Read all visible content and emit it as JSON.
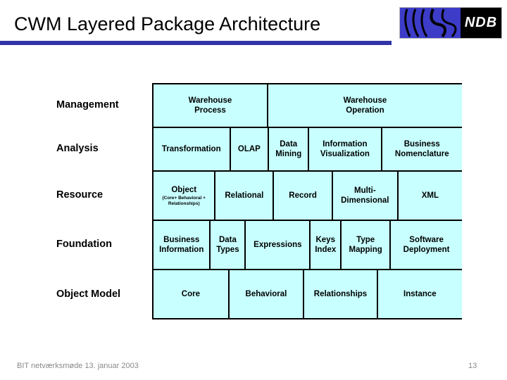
{
  "slide": {
    "title": "CWM Layered Package Architecture",
    "rule_color": "#3333a8",
    "cell_fill": "#c8ffff",
    "border_color": "#000000"
  },
  "logo": {
    "name": "ndb-logo",
    "text": "NDB",
    "mark_color": "#3c3cc8",
    "text_color": "#ffffff",
    "background": "#000000"
  },
  "diagram": {
    "rows": [
      {
        "label": "Management",
        "cells": [
          {
            "main": "Warehouse",
            "second": "Process",
            "width": 37.2
          },
          {
            "main": "Warehouse",
            "second": "Operation",
            "width": 62.8
          }
        ]
      },
      {
        "label": "Analysis",
        "cells": [
          {
            "main": "Transformation",
            "second": "",
            "width": 25.0
          },
          {
            "main": "OLAP",
            "second": "",
            "width": 12.5
          },
          {
            "main": "Data",
            "second": "Mining",
            "width": 13.0
          },
          {
            "main": "Information",
            "second": "Visualization",
            "width": 23.6
          },
          {
            "main": "Business",
            "second": "Nomenclature",
            "width": 25.9
          }
        ]
      },
      {
        "label": "Resource",
        "cells": [
          {
            "main": "Object",
            "sub": "(Core+ Behavioral + Relationships)",
            "second": "",
            "width": 20.2
          },
          {
            "main": "Relational",
            "second": "",
            "width": 18.9
          },
          {
            "main": "Record",
            "second": "",
            "width": 19.1
          },
          {
            "main": "Multi-",
            "second": "Dimensional",
            "width": 21.2
          },
          {
            "main": "XML",
            "second": "",
            "width": 20.6
          }
        ]
      },
      {
        "label": "Foundation",
        "cells": [
          {
            "main": "Business",
            "second": "Information",
            "width": 18.6
          },
          {
            "main": "Data",
            "second": "Types",
            "width": 11.4
          },
          {
            "main": "Expressions",
            "second": "",
            "width": 21.0
          },
          {
            "main": "Keys",
            "second": "Index",
            "width": 10.0
          },
          {
            "main": "Type",
            "second": "Mapping",
            "width": 16.0
          },
          {
            "main": "Software",
            "second": "Deployment",
            "width": 23.0
          }
        ]
      },
      {
        "label": "Object Model",
        "cells": [
          {
            "main": "Core",
            "second": "",
            "width": 24.6
          },
          {
            "main": "Behavioral",
            "second": "",
            "width": 24.3
          },
          {
            "main": "Relationships",
            "second": "",
            "width": 23.9
          },
          {
            "main": "Instance",
            "second": "",
            "width": 27.2
          }
        ]
      }
    ]
  },
  "footer": {
    "note": "BIT netværksmøde 13. januar 2003",
    "page_number": "13"
  }
}
